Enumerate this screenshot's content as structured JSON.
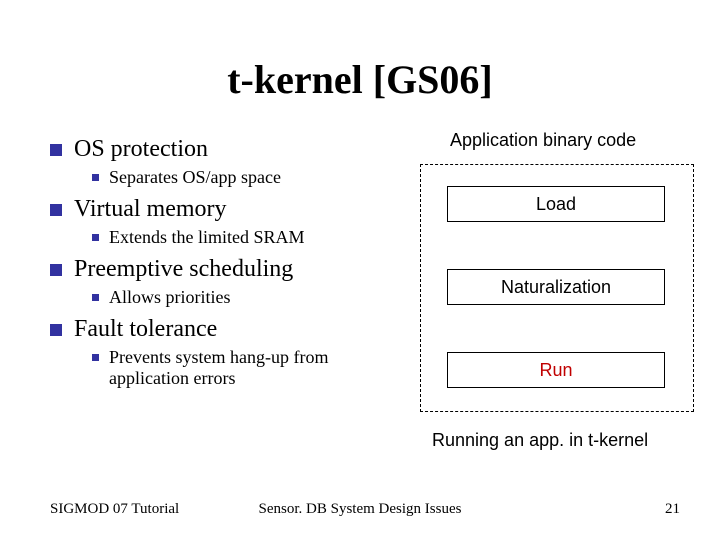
{
  "title": "t-kernel [GS06]",
  "bullets": [
    {
      "text": "OS protection",
      "sub": "Separates OS/app space"
    },
    {
      "text": "Virtual memory",
      "sub": "Extends the limited SRAM"
    },
    {
      "text": "Preemptive scheduling",
      "sub": "Allows priorities"
    },
    {
      "text": "Fault tolerance",
      "sub": "Prevents system hang-up from application errors"
    }
  ],
  "diagram": {
    "header": "Application binary code",
    "stages": [
      "Load",
      "Naturalization",
      "Run"
    ],
    "caption": "Running an app. in t-kernel"
  },
  "footer": {
    "left": "SIGMOD 07 Tutorial",
    "center": "Sensor. DB System Design Issues",
    "right": "21"
  }
}
